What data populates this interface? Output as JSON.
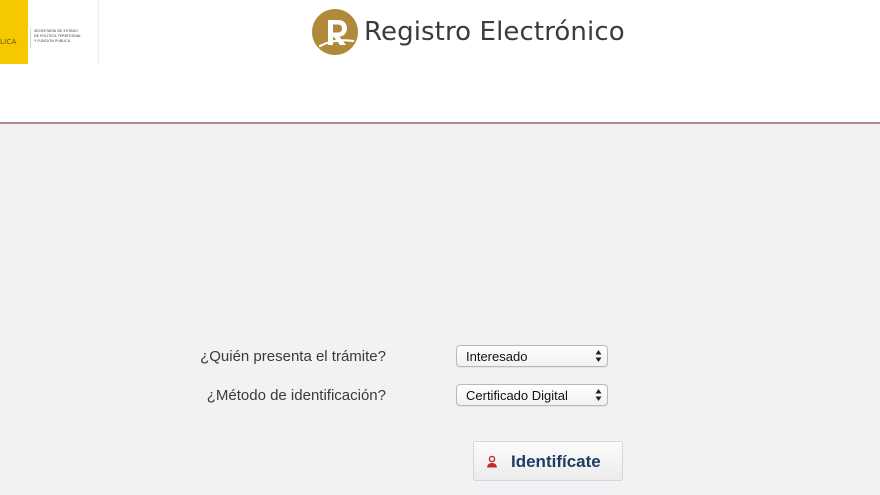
{
  "header": {
    "gov_logo": {
      "yellow_text": "LICA",
      "lines": [
        "SECRETARÍA DE ESTADO",
        "DE POLÍTICA TERRITORIAL",
        "Y FUNCIÓN PÚBLICA"
      ]
    },
    "brand_letter": "R",
    "brand_title": "Registro Electrónico",
    "brand_color": "#b08a3a"
  },
  "form": {
    "presenter": {
      "label": "¿Quién presenta el trámite?",
      "selected": "Interesado"
    },
    "method": {
      "label": "¿Método de identificación?",
      "selected": "Certificado Digital"
    }
  },
  "identify_button": {
    "label": "Identifícate",
    "icon": "user-icon"
  },
  "colors": {
    "divider": "#b9879a",
    "button_text": "#1f3c66",
    "icon_red": "#c62828"
  }
}
